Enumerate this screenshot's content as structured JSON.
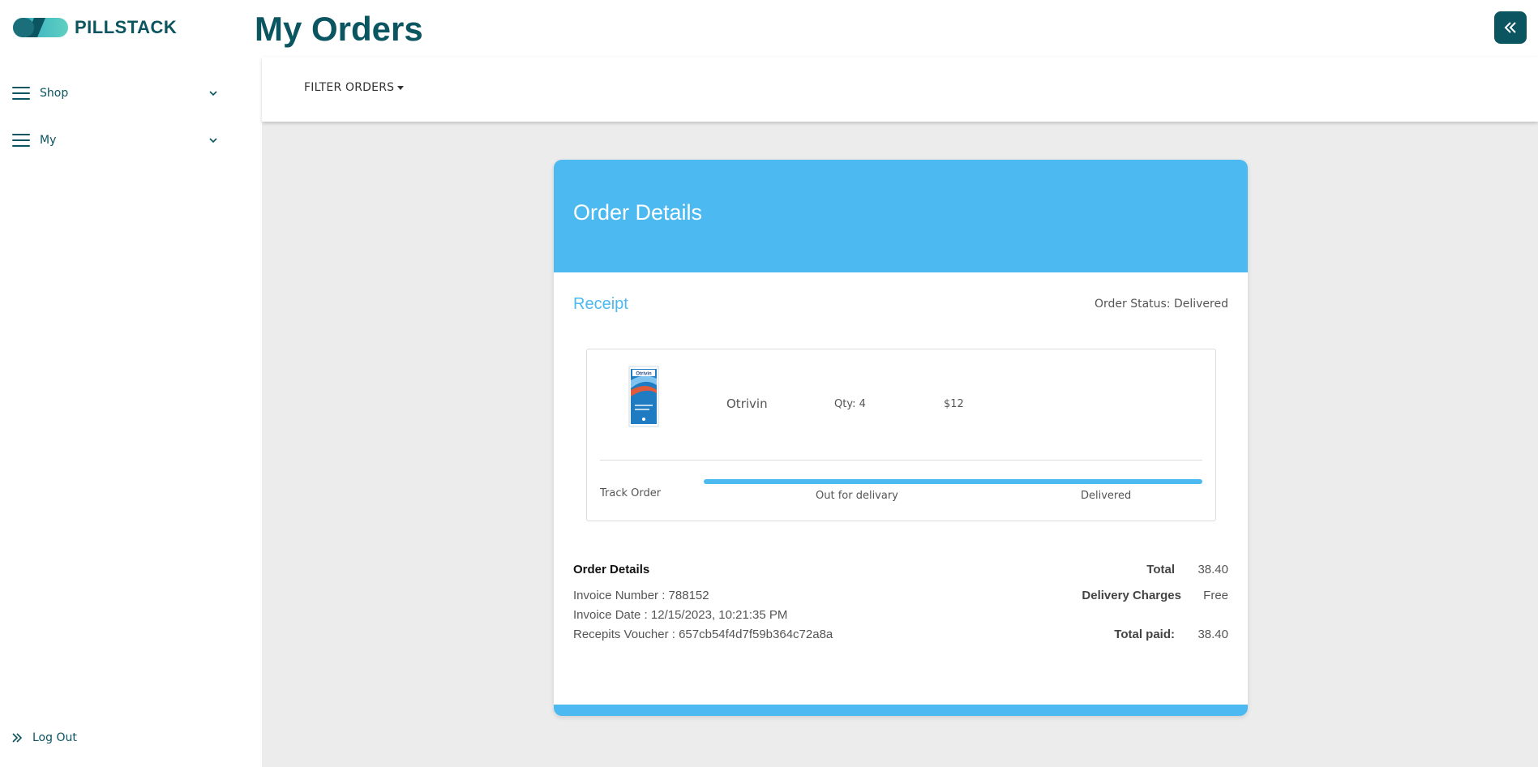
{
  "app": {
    "brand": "PILLSTACK",
    "page_title": "My Orders"
  },
  "sidebar": {
    "items": [
      {
        "label": "Shop",
        "icon": "hamburger-icon"
      },
      {
        "label": "My",
        "icon": "hamburger-icon"
      }
    ],
    "logout_label": "Log Out"
  },
  "toolbar": {
    "filter_label": "FILTER ORDERS"
  },
  "order": {
    "header": "Order Details",
    "receipt_label": "Receipt",
    "status_text": "Order Status: Delivered",
    "item": {
      "name": "Otrivin",
      "qty": "Qty: 4",
      "price": "$12",
      "image_label": "Otrivin"
    },
    "tracking": {
      "label": "Track Order",
      "steps": [
        "Out for delivary",
        "Delivered"
      ],
      "progress": 1.0
    },
    "details": {
      "title": "Order Details",
      "invoice_number": "Invoice Number : 788152",
      "invoice_date": "Invoice Date : 12/15/2023, 10:21:35 PM",
      "voucher": "Recepits Voucher : 657cb54f4d7f59b364c72a8a"
    },
    "summary": {
      "total_label": "Total",
      "total_value": "38.40",
      "delivery_label": "Delivery Charges",
      "delivery_value": "Free",
      "paid_label": "Total paid:",
      "paid_value": "38.40"
    }
  },
  "colors": {
    "brand": "#0b5560",
    "accent": "#4cb9f0",
    "background": "#ececec"
  }
}
